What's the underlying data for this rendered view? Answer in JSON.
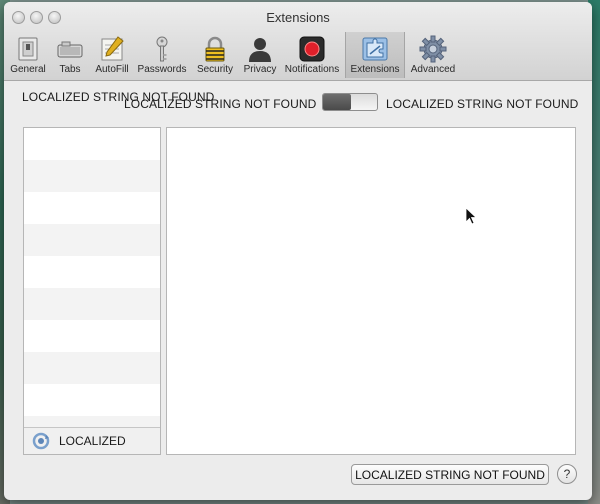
{
  "window": {
    "title": "Extensions"
  },
  "toolbar": {
    "tabs": [
      {
        "label": "General",
        "icon": "general-switch-icon"
      },
      {
        "label": "Tabs",
        "icon": "tabs-icon"
      },
      {
        "label": "AutoFill",
        "icon": "autofill-pencil-icon"
      },
      {
        "label": "Passwords",
        "icon": "key-icon"
      },
      {
        "label": "Security",
        "icon": "padlock-icon"
      },
      {
        "label": "Privacy",
        "icon": "person-silhouette-icon"
      },
      {
        "label": "Notifications",
        "icon": "notification-icon"
      },
      {
        "label": "Extensions",
        "icon": "puzzle-icon"
      },
      {
        "label": "Advanced",
        "icon": "gear-icon"
      }
    ],
    "selected": "Extensions"
  },
  "settings": {
    "top_label": "LOCALIZED STRING NOT FOUND",
    "toggle_left_label": "LOCALIZED STRING NOT FOUND",
    "toggle_right_label": "LOCALIZED STRING NOT FOUND",
    "toggle_state": "off"
  },
  "list": {
    "footer_label": "LOCALIZED",
    "footer_icon": "refresh-arrows-icon"
  },
  "footer": {
    "button_label": "LOCALIZED STRING NOT FOUND",
    "help_label": "?"
  },
  "colors": {
    "notification_red": "#e0202a",
    "selected_tab": "#c4c4c4"
  }
}
